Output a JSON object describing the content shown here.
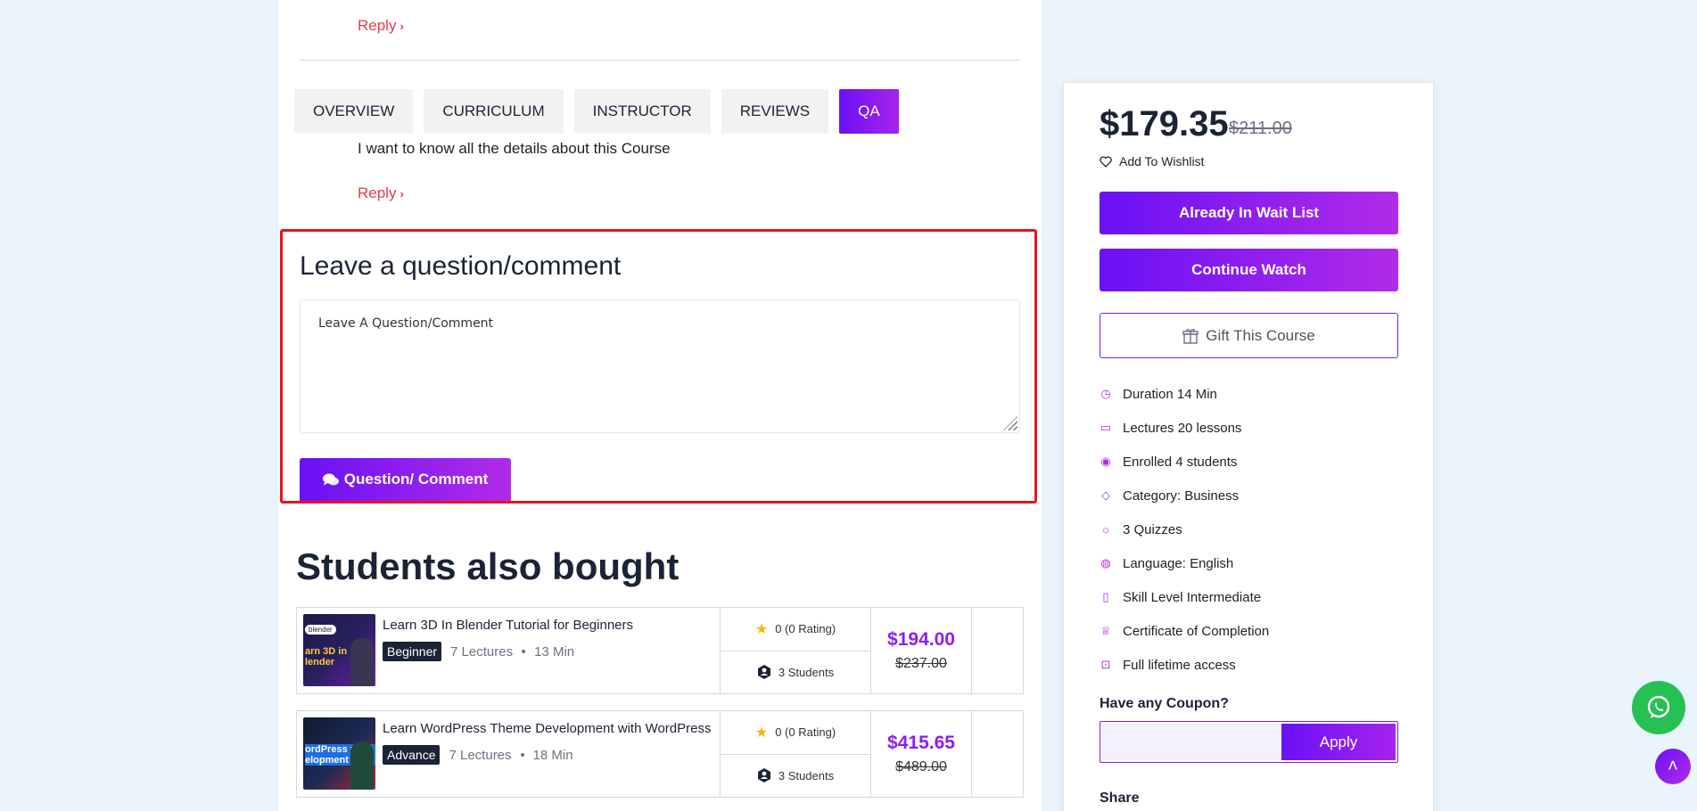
{
  "qa": {
    "reply_label": "Reply",
    "comment_text": "I want to know all the details about this Course"
  },
  "tabs": [
    {
      "label": "OVERVIEW"
    },
    {
      "label": "CURRICULUM"
    },
    {
      "label": "INSTRUCTOR"
    },
    {
      "label": "REVIEWS"
    },
    {
      "label": "QA"
    }
  ],
  "form": {
    "title": "Leave a question/comment",
    "placeholder": "Leave A Question/Comment",
    "submit_label": "Question/ Comment"
  },
  "also_bought": {
    "title": "Students also bought",
    "courses": [
      {
        "title": "Learn 3D In Blender Tutorial for Beginners",
        "level": "Beginner",
        "lectures": "7 Lectures",
        "duration": "13 Min",
        "rating": "0 (0 Rating)",
        "students": "3 Students",
        "price": "$194.00",
        "old_price": "$237.00",
        "thumb_tag": "blender",
        "thumb_text": "arn 3D in lender"
      },
      {
        "title": "Learn WordPress Theme Development with WordPress",
        "level": "Advance",
        "lectures": "7 Lectures",
        "duration": "18 Min",
        "rating": "0 (0 Rating)",
        "students": "3 Students",
        "price": "$415.65",
        "old_price": "$489.00",
        "thumb_tag": "",
        "thumb_text": "ordPress me elopment"
      }
    ]
  },
  "sidebar": {
    "price": "$179.35",
    "old_price": "$211.00",
    "wishlist_label": "Add To Wishlist",
    "waitlist_label": "Already In Wait List",
    "continue_label": "Continue Watch",
    "gift_label": "Gift This Course",
    "meta": [
      {
        "icon": "clock-icon",
        "text": "Duration 14 Min"
      },
      {
        "icon": "book-icon",
        "text": "Lectures 20 lessons"
      },
      {
        "icon": "user-icon",
        "text": "Enrolled 4 students"
      },
      {
        "icon": "tag-icon",
        "text": "Category: Business"
      },
      {
        "icon": "chat-icon",
        "text": "3 Quizzes"
      },
      {
        "icon": "globe-icon",
        "text": "Language: English"
      },
      {
        "icon": "level-icon",
        "text": "Skill Level Intermediate"
      },
      {
        "icon": "trophy-icon",
        "text": "Certificate of Completion"
      },
      {
        "icon": "lock-icon",
        "text": "Full lifetime access"
      }
    ],
    "coupon_label": "Have any Coupon?",
    "apply_label": "Apply",
    "share_label": "Share"
  },
  "colors": {
    "accent_start": "#6a11f5",
    "accent_end": "#b12be8",
    "reply": "#e63950",
    "highlight": "#e8141c",
    "whatsapp": "#25c253"
  }
}
